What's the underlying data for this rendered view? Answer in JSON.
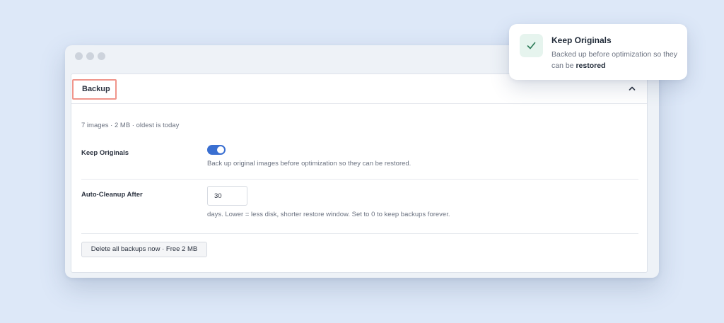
{
  "panel": {
    "title": "Backup",
    "meta": "7 images · 2 MB · oldest is today"
  },
  "settings": {
    "keep_originals": {
      "label": "Keep Originals",
      "enabled": true,
      "help": "Back up original images before optimization so they can be restored."
    },
    "auto_cleanup": {
      "label": "Auto-Cleanup After",
      "value": "30",
      "help": "days. Lower = less disk, shorter restore window. Set to 0 to keep backups forever."
    }
  },
  "actions": {
    "delete_all_label": "Delete all backups now · Free 2 MB"
  },
  "toast": {
    "title": "Keep Originals",
    "body_prefix": "Backed up before optimization so they can be ",
    "body_emphasis": "restored"
  },
  "icons": {
    "collapse": "chevron-up-icon",
    "check": "check-icon"
  },
  "colors": {
    "accent": "#3a6fd1",
    "highlight_border": "#f0958b",
    "success_bg": "#e6f4ee",
    "success_fg": "#2f7d5a"
  }
}
